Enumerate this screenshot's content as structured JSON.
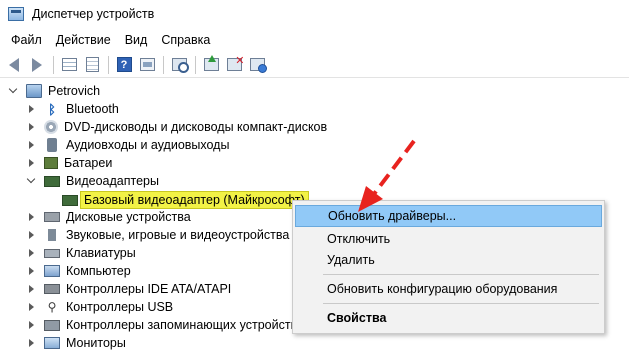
{
  "window": {
    "title": "Диспетчер устройств"
  },
  "menu": [
    "Файл",
    "Действие",
    "Вид",
    "Справка"
  ],
  "toolbar": {
    "buttons": [
      "back-icon",
      "forward-icon",
      "properties-grid-icon",
      "sheet-icon",
      "help-icon",
      "panel-icon",
      "scan-hardware-icon",
      "update-driver-icon",
      "uninstall-icon",
      "disable-icon"
    ],
    "help_glyph": "?"
  },
  "tree": {
    "root": "Petrovich",
    "bluetooth_glyph": "ᛒ",
    "usb_glyph": "⚲",
    "items": [
      {
        "label": "Bluetooth",
        "icon": "bluetooth-icon",
        "expanded": false
      },
      {
        "label": "DVD-дисководы и дисководы компакт-дисков",
        "icon": "dvd-icon",
        "expanded": false
      },
      {
        "label": "Аудиовходы и аудиовыходы",
        "icon": "audio-icon",
        "expanded": false
      },
      {
        "label": "Батареи",
        "icon": "battery-icon",
        "expanded": false
      },
      {
        "label": "Видеоадаптеры",
        "icon": "video-adapter-icon",
        "expanded": true
      },
      {
        "label": "Базовый видеоадаптер (Майкрософт)",
        "icon": "video-card-icon",
        "child": true,
        "selected": true
      },
      {
        "label": "Дисковые устройства",
        "icon": "disk-icon",
        "expanded": false
      },
      {
        "label": "Звуковые, игровые и видеоустройства",
        "icon": "sound-icon",
        "expanded": false
      },
      {
        "label": "Клавиатуры",
        "icon": "keyboard-icon",
        "expanded": false
      },
      {
        "label": "Компьютер",
        "icon": "computer-icon",
        "expanded": false
      },
      {
        "label": "Контроллеры IDE ATA/ATAPI",
        "icon": "ide-controller-icon",
        "expanded": false
      },
      {
        "label": "Контроллеры USB",
        "icon": "usb-icon",
        "expanded": false
      },
      {
        "label": "Контроллеры запоминающих устройств",
        "icon": "storage-controller-icon",
        "expanded": false
      },
      {
        "label": "Мониторы",
        "icon": "monitor-icon",
        "expanded": false
      }
    ]
  },
  "context_menu": {
    "items": [
      {
        "label": "Обновить драйверы...",
        "hovered": true
      },
      {
        "label": "Отключить"
      },
      {
        "label": "Удалить"
      },
      {
        "label": "Обновить конфигурацию оборудования"
      },
      {
        "label": "Свойства",
        "bold": true
      }
    ]
  },
  "colors": {
    "selection_highlight": "#f2f246",
    "menu_hover": "#91c9f7",
    "annotation_arrow": "#e8231f"
  }
}
